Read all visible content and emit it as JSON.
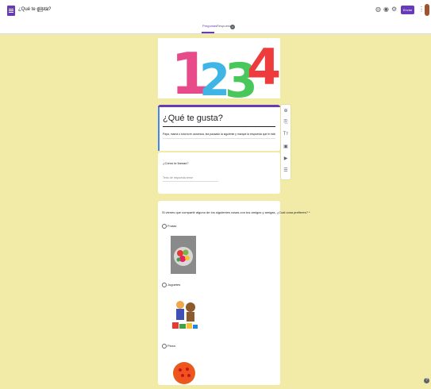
{
  "header": {
    "doc_title": "¿Qué te gusta?",
    "tabs": [
      {
        "label": "Preguntas"
      },
      {
        "label": "Respuestas"
      }
    ],
    "responses_count": "2",
    "send_label": "Enviar"
  },
  "form": {
    "title": "¿Qué te gusta?",
    "description": "Papá, mamá o tutor/a en ausencia, lea pausado la siguiente y marque la respuesta que le indique."
  },
  "questions": [
    {
      "text": "¿Cómo te llamas?",
      "placeholder": "Texto de respuesta breve"
    },
    {
      "text": "Si vienes que compartir alguno de los siguientes cosas con tus amigos y amigas, ¿Cuál cosa prefieres? *",
      "options": [
        {
          "label": "Frutas"
        },
        {
          "label": "Juguetes"
        },
        {
          "label": "Pizza"
        }
      ]
    }
  ],
  "colors": {
    "accent": "#673ab7",
    "background": "#f2eba8"
  }
}
